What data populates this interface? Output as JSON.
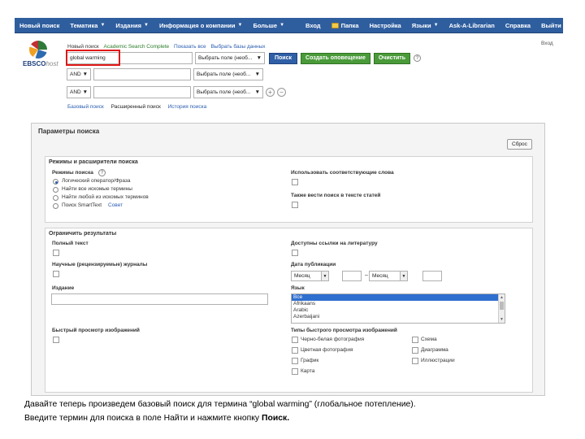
{
  "nav": {
    "left": [
      "Новый поиск",
      "Тематика",
      "Издания",
      "Информация о компании",
      "Больше"
    ],
    "right": [
      "Вход",
      "Папка",
      "Настройка",
      "Языки",
      "Ask-A-Librarian",
      "Справка",
      "Выйти"
    ]
  },
  "header": {
    "logo_brand": "EBSCO",
    "logo_suffix": "host",
    "new_search_links": [
      "Новый поиск",
      "Academic Search Complete",
      "Показать все",
      "Выбрать базы данных"
    ],
    "sign_in": "Вход",
    "search_term": "global warming",
    "field_placeholder": "Выбрать поле (необ...",
    "bool_value": "AND",
    "search_button": "Поиск",
    "alert_button": "Создать оповещение",
    "clear_button": "Очистить",
    "help": "?",
    "subnav": [
      "Базовый поиск",
      "Расширенный поиск",
      "История поиска"
    ]
  },
  "panel": {
    "title": "Параметры поиска",
    "reset": "Сброс",
    "modes": {
      "title": "Режимы и расширители поиска",
      "modes_label": "Режимы поиска",
      "radios": [
        "Логический оператор/Фраза",
        "Найти все искомые термины",
        "Найти любой из искомых терминов",
        "Поиск SmartText"
      ],
      "smarttext_hint": "Совет",
      "related_words": "Использовать соответствующие слова",
      "fulltext_search": "Также вести поиск в тексте статей"
    },
    "limits": {
      "title": "Ограничить результаты",
      "full_text": "Полный текст",
      "references": "Доступны ссылки на литературу",
      "peer_reviewed": "Научные (рецензируемые) журналы",
      "pub_date": "Дата публикации",
      "month": "Месяц",
      "publication": "Издание",
      "language": "Язык",
      "languages": [
        "Все",
        "Afrikaans",
        "Arabic",
        "Azerbaijani"
      ],
      "quick_view": "Быстрый просмотр изображений",
      "quick_view_types": "Типы быстрого просмотра изображений",
      "image_types_left": [
        "Черно-белая фотография",
        "Цветная фотография",
        "График",
        "Карта"
      ],
      "image_types_right": [
        "Схема",
        "Диаграмма",
        "Иллюстрации"
      ]
    }
  },
  "caption": {
    "line1": "Давайте теперь произведем базовый поиск для термина “global warming” (глобальное потепление).",
    "line2_prefix": "Введите термин для поиска в поле Найти и нажмите кнопку ",
    "line2_bold": "Поиск."
  }
}
